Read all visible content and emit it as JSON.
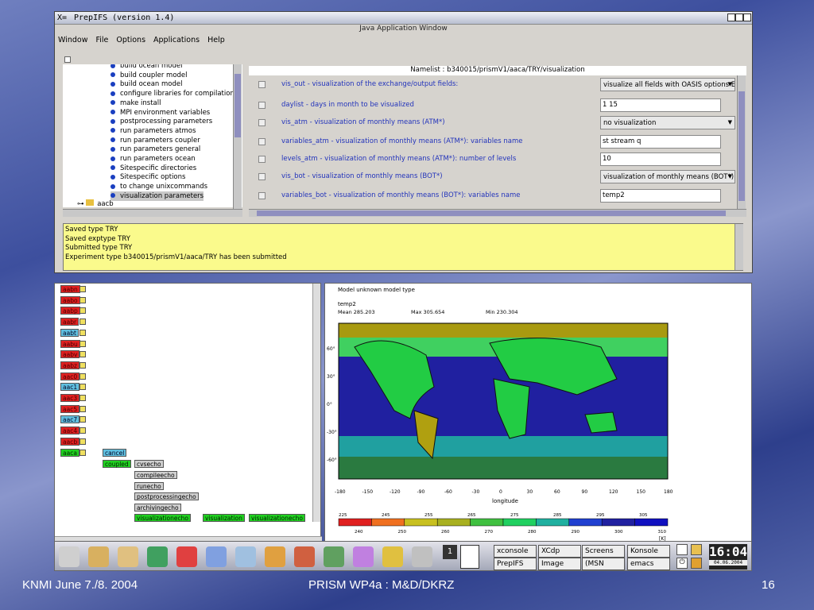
{
  "window": {
    "title": "PrepIFS (version 1.4)",
    "subtitle": "Java Application Window",
    "menu": [
      "Window",
      "File",
      "Options",
      "Applications",
      "Help"
    ]
  },
  "tree": {
    "items": [
      "build ocean model",
      "build coupler model",
      "build ocean model",
      "configure libraries for compilation",
      "make install",
      "MPI environment variables",
      "postprocessing parameters",
      "run parameters atmos",
      "run parameters coupler",
      "run parameters general",
      "run parameters ocean",
      "Sitespecific directories",
      "Sitespecific options",
      "to change unixcommands",
      "visualization parameters"
    ],
    "folder": "aacb"
  },
  "namelist": {
    "title": "Namelist : b340015/prismV1/aaca/TRY/visualization",
    "rows": [
      {
        "label": "vis_out - visualization of the exchange/output fields:",
        "value": "visualize all fields with OASIS options EXPO",
        "kind": "dd"
      },
      {
        "label": "daylist - days in month to be visualized",
        "value": "1 15",
        "kind": "fld"
      },
      {
        "label": "vis_atm - visualization of monthly means (ATM*)",
        "value": "no visualization",
        "kind": "dd"
      },
      {
        "label": "variables_atm - visualization of monthly means (ATM*): variables name",
        "value": "st stream q",
        "kind": "fld"
      },
      {
        "label": "levels_atm - visualization of monthly means (ATM*): number of levels",
        "value": "10",
        "kind": "fld"
      },
      {
        "label": "vis_bot - visualization of monthly means (BOT*)",
        "value": "visualization of monthly means (BOT*)",
        "kind": "dd"
      },
      {
        "label": "variables_bot - visualization of monthly means (BOT*): variables name",
        "value": "temp2",
        "kind": "fld"
      }
    ]
  },
  "log": [
    "Saved type TRY",
    "Saved exptype TRY",
    "Submitted type TRY",
    "Experiment type b340015/prismV1/aaca/TRY has been submitted"
  ],
  "flow": {
    "nodes": [
      {
        "t": "aabn",
        "k": "r"
      },
      {
        "t": "aabo",
        "k": "r"
      },
      {
        "t": "aabp",
        "k": "r"
      },
      {
        "t": "aabr",
        "k": "r"
      },
      {
        "t": "aabt",
        "k": "c"
      },
      {
        "t": "aabu",
        "k": "r"
      },
      {
        "t": "aabv",
        "k": "r"
      },
      {
        "t": "aabz",
        "k": "r"
      },
      {
        "t": "aac0",
        "k": "r"
      },
      {
        "t": "aac1",
        "k": "c"
      },
      {
        "t": "aac3",
        "k": "r"
      },
      {
        "t": "aac5",
        "k": "r"
      },
      {
        "t": "aac7",
        "k": "c"
      },
      {
        "t": "aac4",
        "k": "r"
      },
      {
        "t": "aacb",
        "k": "r"
      },
      {
        "t": "aaca",
        "k": "g"
      }
    ],
    "cancel": "cancel",
    "coupled": "coupled",
    "jobs": [
      "cvsecho",
      "compileecho",
      "runecho",
      "postprocessingecho",
      "archivingecho"
    ],
    "chain": [
      "visualizationecho",
      "visualization",
      "visualizationecho"
    ]
  },
  "plot": {
    "header": "Model unknown model type",
    "var": "temp2",
    "mean": "Mean 285.203",
    "max": "Max 305.654",
    "min": "Min 230.304",
    "yticks": [
      "60°",
      "30°",
      "0°",
      "-30°",
      "-60°"
    ],
    "xticks": [
      "-180",
      "-150",
      "-120",
      "-90",
      "-60",
      "-30",
      "0",
      "30",
      "60",
      "90",
      "120",
      "150",
      "180"
    ],
    "xlabel": "longitude",
    "cbar_top": [
      "225",
      "245",
      "255",
      "265",
      "275",
      "285",
      "295",
      "305"
    ],
    "cbar_bot": [
      "240",
      "250",
      "260",
      "270",
      "280",
      "290",
      "300",
      "310"
    ],
    "cbar_unit": "[K]"
  },
  "taskbar": {
    "desk": "1",
    "tasks": [
      "xconsole",
      "XCdp",
      "Screens",
      "Konsole",
      "PrepIFS",
      "Image",
      "(MSN",
      "emacs"
    ],
    "time": "16:04",
    "date": "04.06.2004"
  },
  "footer": {
    "left": "KNMI June 7./8. 2004",
    "center": "PRISM WP4a :  M&D/DKRZ",
    "right": "16"
  },
  "colors": {
    "log_bg": "#fafa8c",
    "map_ocean": "#2020a0",
    "map_green": "#20c840"
  }
}
